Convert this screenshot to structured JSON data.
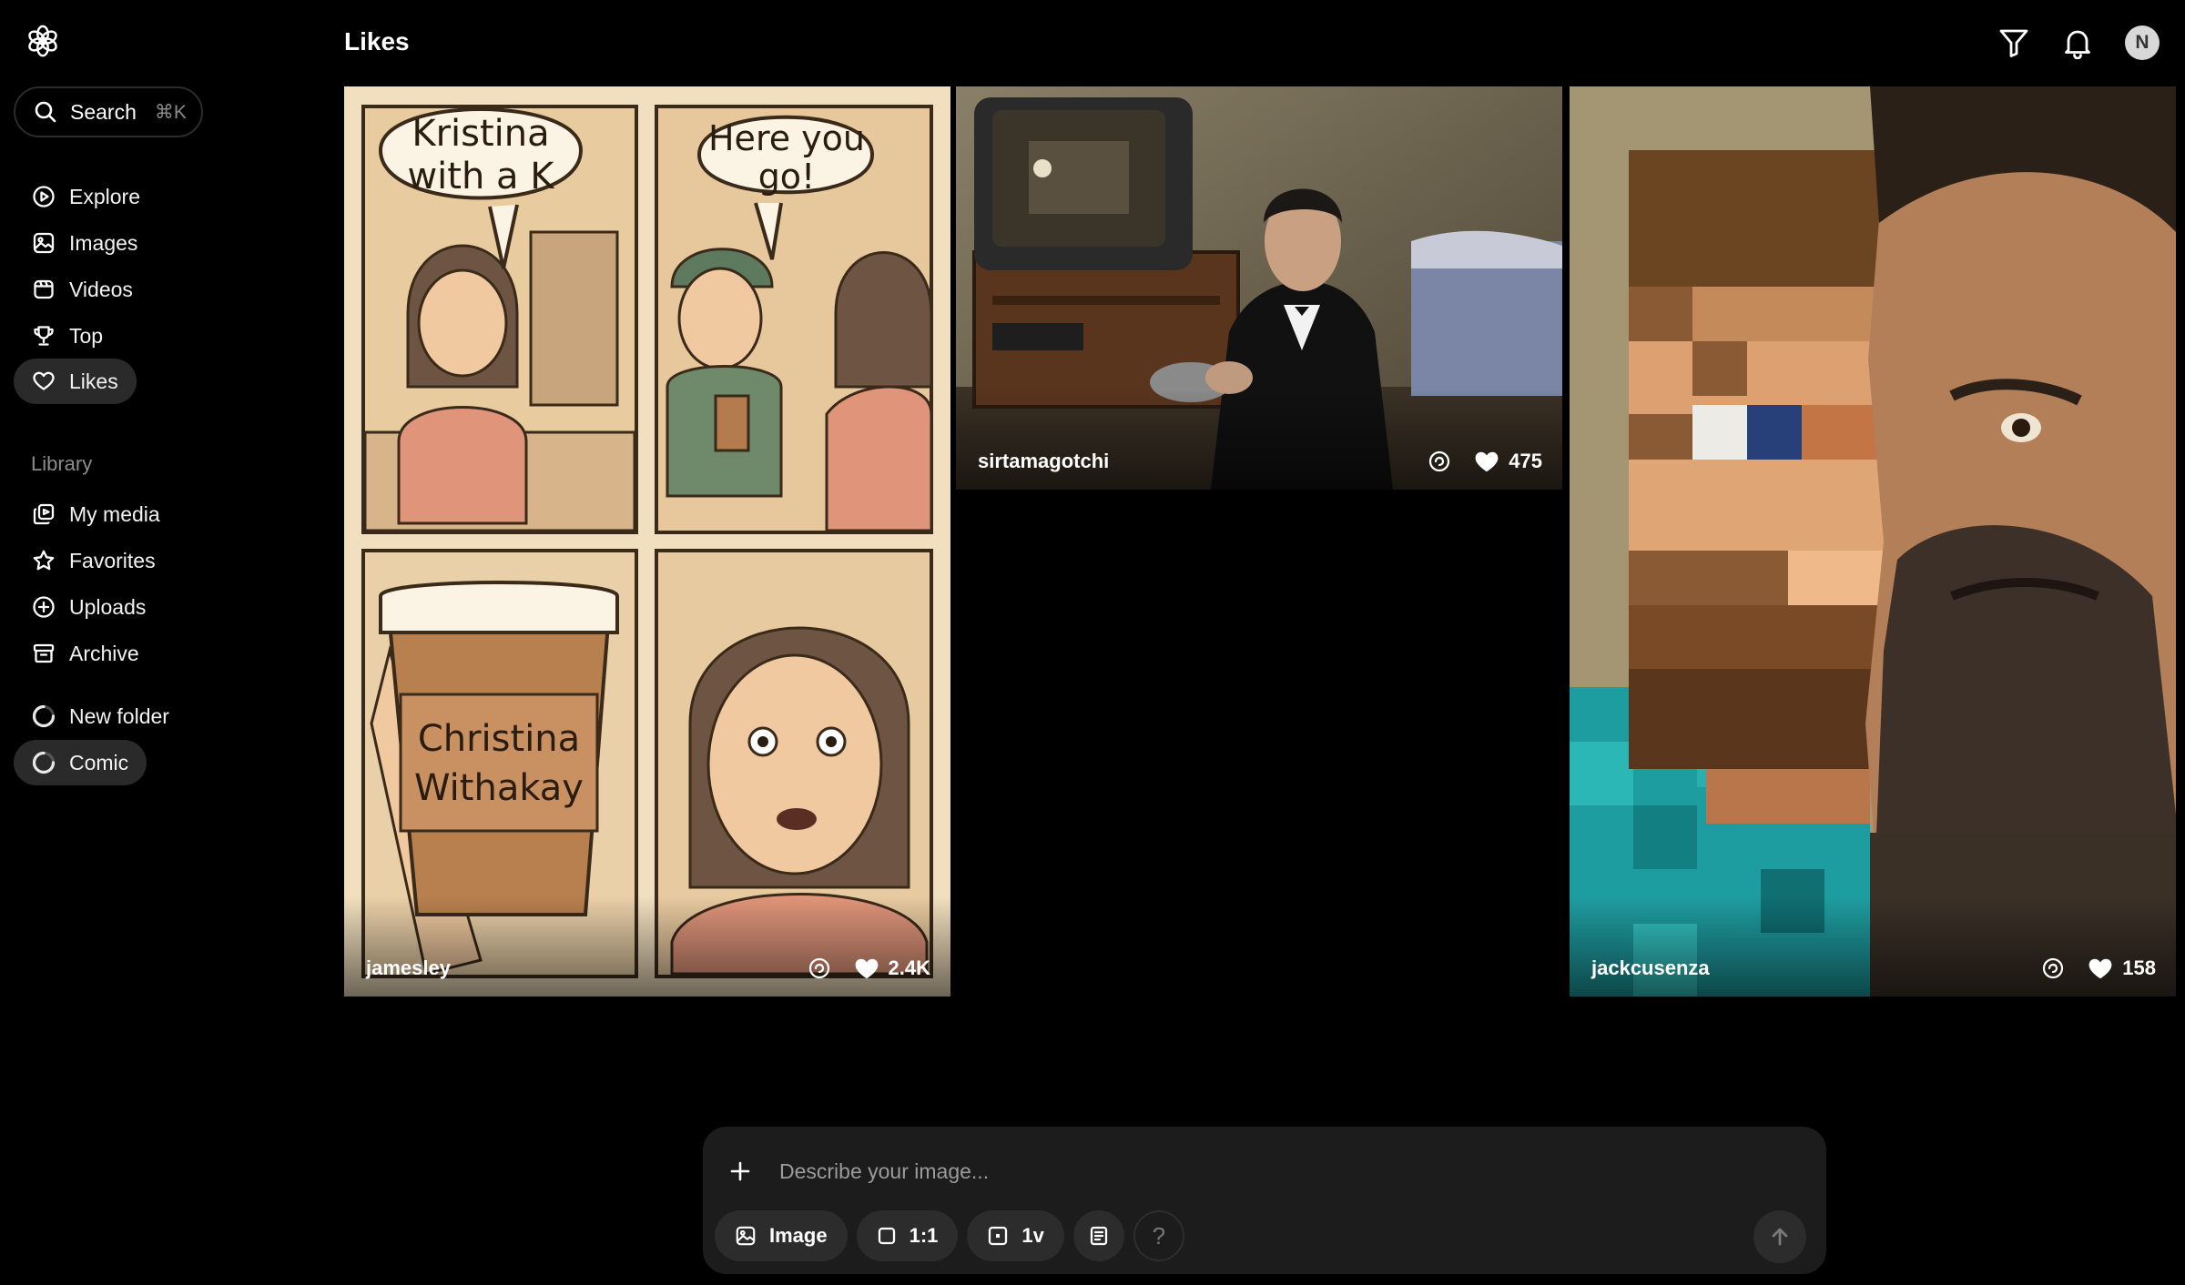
{
  "header": {
    "title": "Likes"
  },
  "sidebar": {
    "search_label": "Search",
    "search_shortcut": "⌘K",
    "nav": [
      {
        "label": "Explore",
        "icon": "explore-icon"
      },
      {
        "label": "Images",
        "icon": "images-icon"
      },
      {
        "label": "Videos",
        "icon": "videos-icon"
      },
      {
        "label": "Top",
        "icon": "trophy-icon"
      },
      {
        "label": "Likes",
        "icon": "heart-icon",
        "active": true
      }
    ],
    "library_label": "Library",
    "library": [
      {
        "label": "My media",
        "icon": "my-media-icon"
      },
      {
        "label": "Favorites",
        "icon": "star-icon"
      },
      {
        "label": "Uploads",
        "icon": "upload-icon"
      },
      {
        "label": "Archive",
        "icon": "archive-icon"
      }
    ],
    "folders": [
      {
        "label": "New folder",
        "icon": "folder-spinner-icon"
      },
      {
        "label": "Comic",
        "icon": "folder-spinner-icon",
        "active": true
      }
    ]
  },
  "topbar": {
    "avatar_initial": "N"
  },
  "feed": [
    {
      "user": "jamesley",
      "likes": "2.4K",
      "comic_text": {
        "bubble1": [
          "Kristina",
          "with a K"
        ],
        "bubble2": [
          "Here you",
          "go!"
        ],
        "cup": [
          "Christina",
          "Withakay"
        ]
      }
    },
    {
      "user": "sirtamagotchi",
      "likes": "475"
    },
    {
      "user": "jackcusenza",
      "likes": "158"
    }
  ],
  "composer": {
    "placeholder": "Describe your image...",
    "mode_label": "Image",
    "aspect_label": "1:1",
    "variations_label": "1v",
    "help_label": "?"
  },
  "colors": {
    "background": "#000000",
    "panel": "#1c1c1c",
    "chip": "#2c2c2c",
    "active_nav": "#2a2a2a"
  }
}
